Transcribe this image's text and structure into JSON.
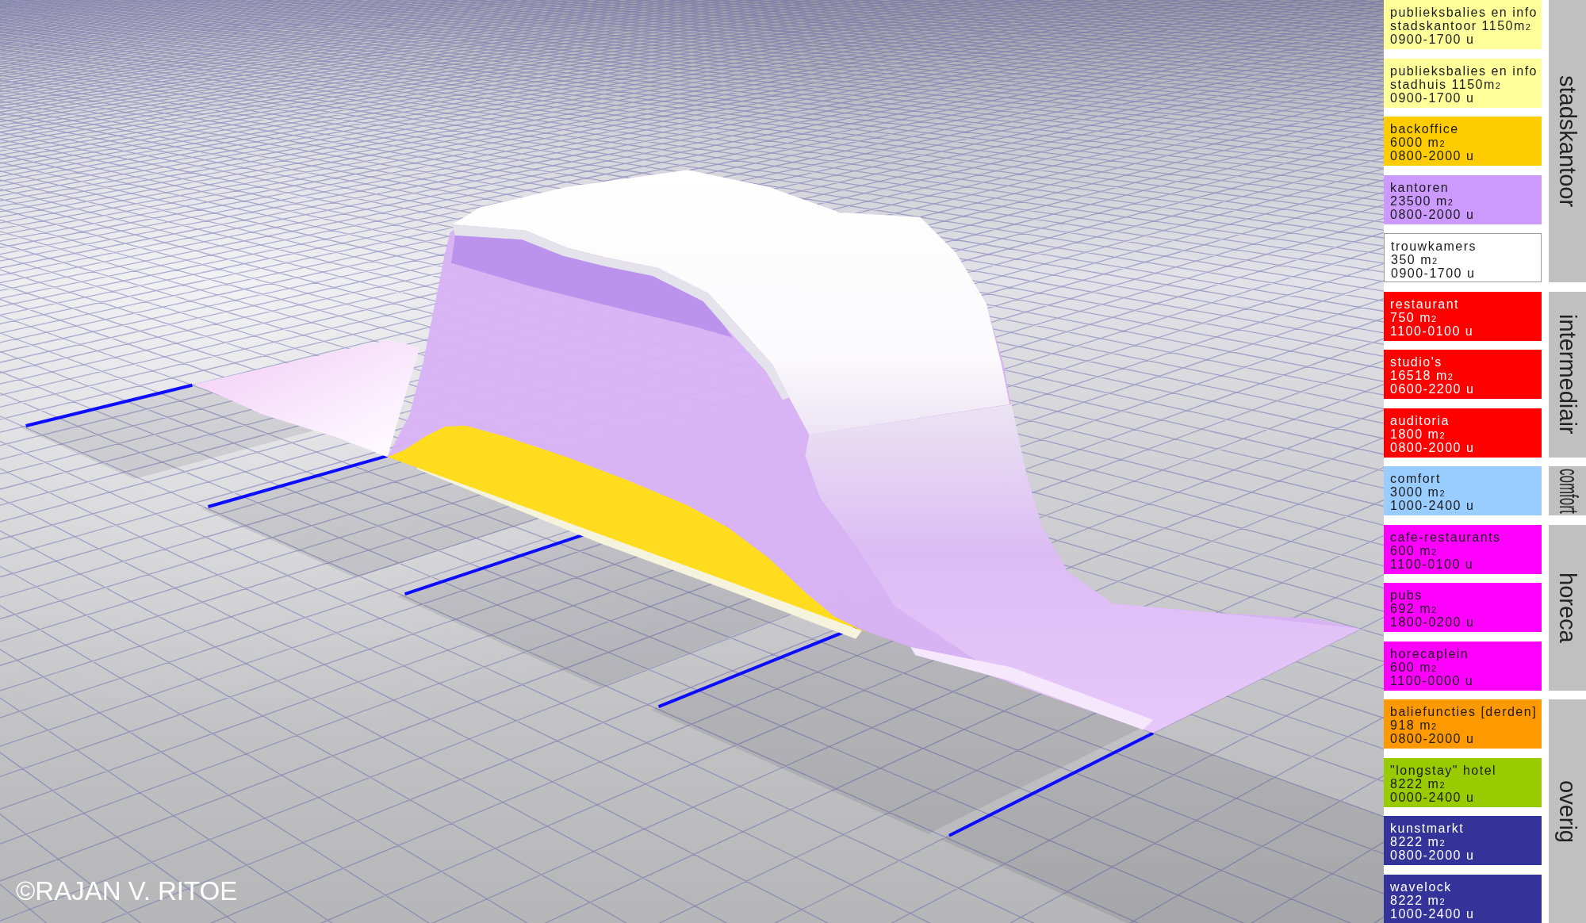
{
  "legend": {
    "groups": [
      {
        "label": "stadskantoor",
        "items": [
          {
            "lines": [
              "publieksbalies en info",
              "stadskantoor 1150m$_{2}$",
              "0900-1700 u"
            ],
            "color": "#ffff99"
          },
          {
            "lines": [
              "publieksbalies en info",
              "stadhuis 1150m$_{2}$",
              "0900-1700 u"
            ],
            "color": "#ffff99"
          },
          {
            "lines": [
              "backoffice",
              "6000 m$_{2}$",
              "0800-2000 u"
            ],
            "color": "#ffcc00"
          },
          {
            "lines": [
              "kantoren",
              "23500 m$_{2}$",
              "0800-2000 u"
            ],
            "color": "#cc99ff"
          },
          {
            "lines": [
              "trouwkamers",
              "350 m$_{2}$",
              "0900-1700 u"
            ],
            "color": "#ffffff"
          }
        ]
      },
      {
        "label": "intermediair",
        "items": [
          {
            "lines": [
              "restaurant",
              "750 m$_{2}$",
              "1100-0100 u"
            ],
            "color": "#ff0000"
          },
          {
            "lines": [
              "studio's",
              "16518 m$_{2}$",
              "0600-2200 u"
            ],
            "color": "#ff0000"
          },
          {
            "lines": [
              "auditoria",
              "1800 m$_{2}$",
              "0800-2000 u"
            ],
            "color": "#ff0000"
          }
        ]
      },
      {
        "label": "comfort",
        "items": [
          {
            "lines": [
              "comfort",
              "3000 m$_{2}$",
              "1000-2400 u"
            ],
            "color": "#99ccff"
          }
        ]
      },
      {
        "label": "horeca",
        "items": [
          {
            "lines": [
              "cafe-restaurants",
              "600 m$_{2}$",
              "1100-0100 u"
            ],
            "color": "#ff00ff"
          },
          {
            "lines": [
              "pubs",
              "692 m$_{2}$",
              "1800-0200 u"
            ],
            "color": "#ff00ff"
          },
          {
            "lines": [
              "horecaplein",
              "600 m$_{2}$",
              "1100-0000 u"
            ],
            "color": "#ff00ff"
          }
        ]
      },
      {
        "label": "overig",
        "items": [
          {
            "lines": [
              "baliefuncties [derden]",
              "918 m$_{2}$",
              "0800-2000 u"
            ],
            "color": "#ff9900"
          },
          {
            "lines": [
              "\"longstay\" hotel",
              "8222 m$_{2}$",
              "0000-2400 u"
            ],
            "color": "#99cc00"
          },
          {
            "lines": [
              "kunstmarkt",
              "8222 m$_{2}$",
              "0800-2000 u"
            ],
            "color": "#333399"
          },
          {
            "lines": [
              "wavelock",
              "8222 m$_{2}$",
              "1000-2400 u"
            ],
            "color": "#333399"
          }
        ]
      }
    ]
  },
  "credit": "©RAJAN V. RITOE"
}
